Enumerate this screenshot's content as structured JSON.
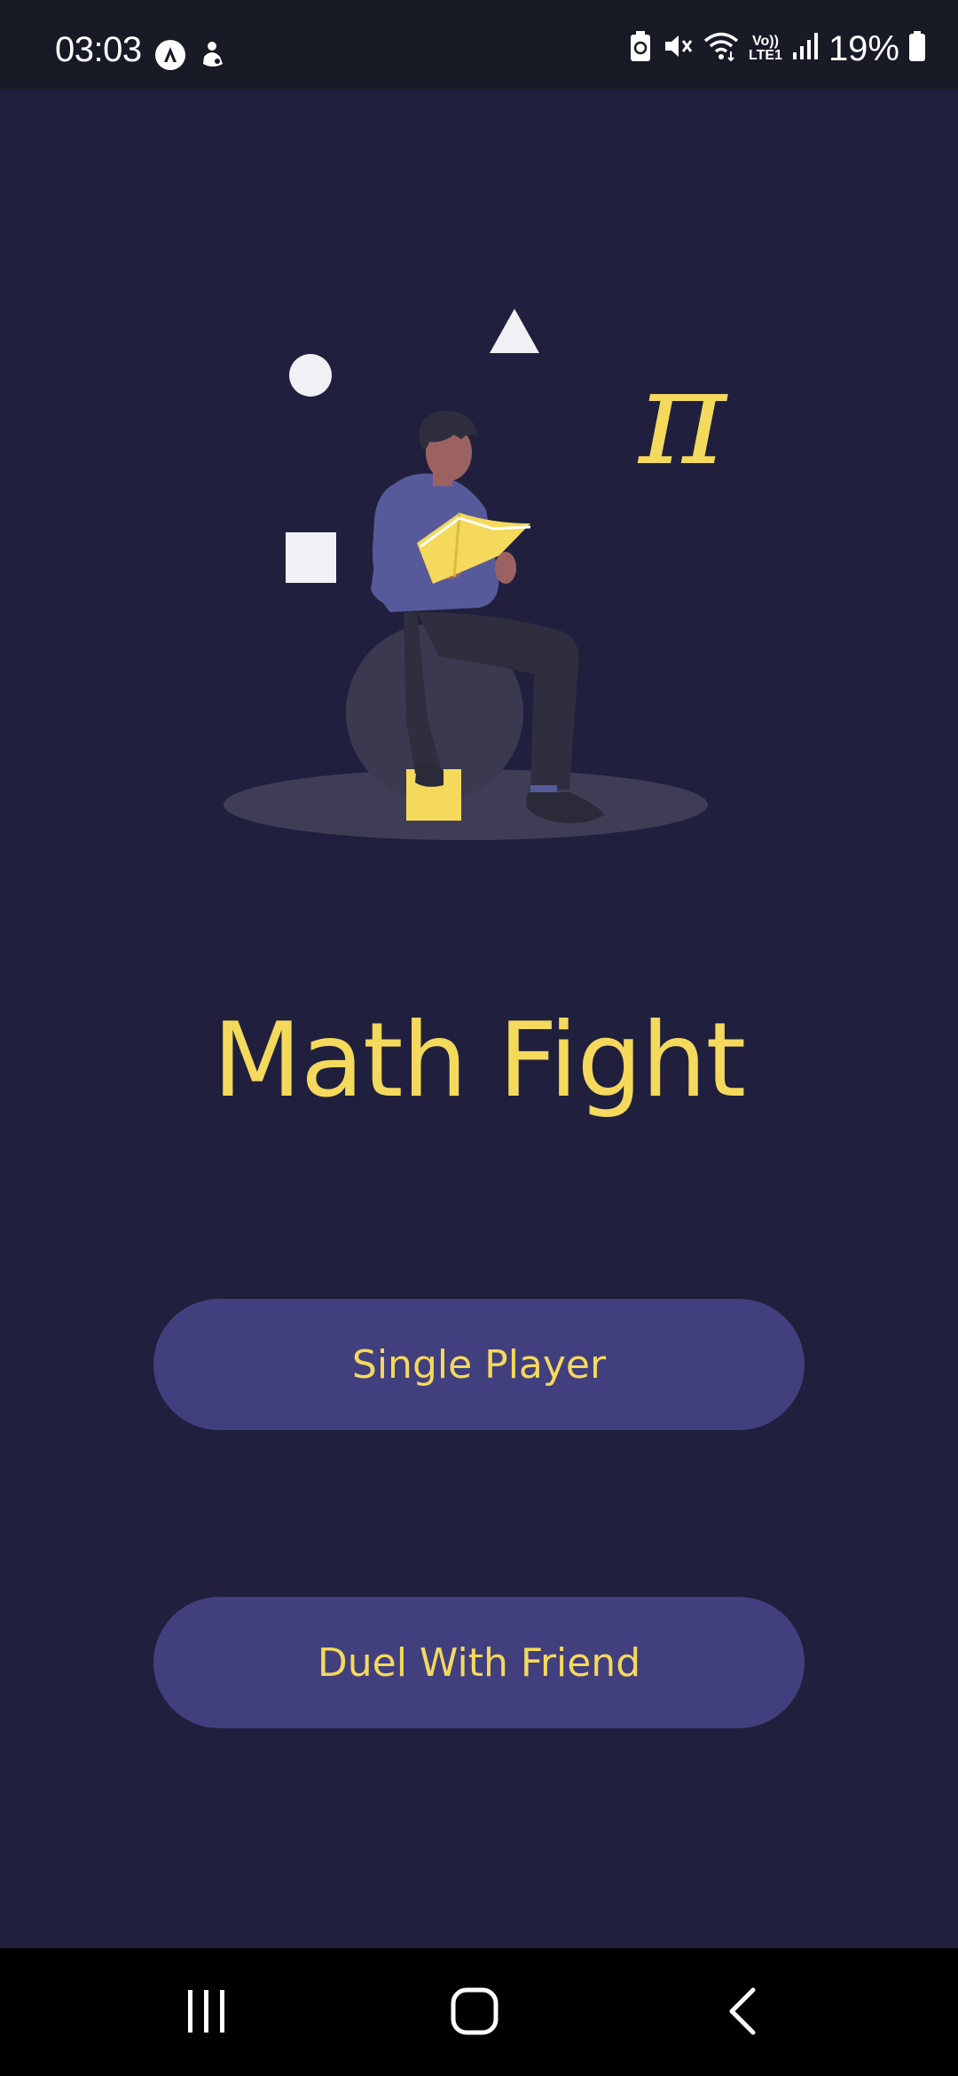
{
  "status_bar": {
    "time": "03:03",
    "left_icons": [
      "notification-a-icon",
      "profile-notification-icon"
    ],
    "right_icons": [
      "battery-saver-icon",
      "mute-icon",
      "wifi-icon",
      "volte-icon",
      "signal-icon",
      "battery-icon"
    ],
    "volte_label": "Vo))",
    "lte_label": "LTE1",
    "battery_percent": "19%"
  },
  "illustration": {
    "description_icon": "reading-person-illustration",
    "pi_symbol": "π",
    "colors": {
      "accent": "#f4d95c",
      "shape": "#f0f0f5",
      "shirt": "#575a9a",
      "skin": "#9c6262",
      "pants": "#2f2e3f",
      "ball": "#3a3950",
      "ground": "#3f3d56"
    }
  },
  "app": {
    "title": "Math Fight"
  },
  "menu": {
    "single_player_label": "Single Player",
    "duel_label": "Duel With Friend"
  },
  "nav_bar": {
    "recents_icon": "recents-icon",
    "home_icon": "home-icon",
    "back_icon": "back-icon"
  },
  "theme": {
    "background": "#20203e",
    "button_bg": "#423f7f",
    "text_accent": "#f4d95c",
    "status_bar_bg": "#181a26",
    "nav_bar_bg": "#000000"
  }
}
